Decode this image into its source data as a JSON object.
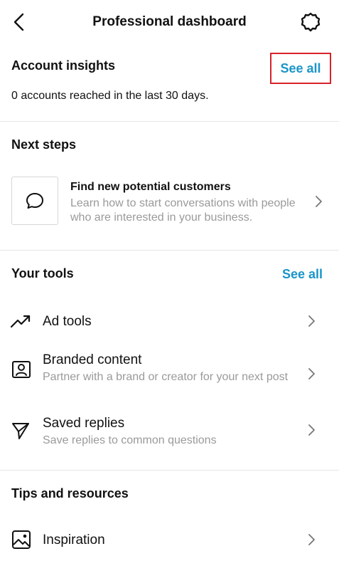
{
  "header": {
    "title": "Professional dashboard"
  },
  "account_insights": {
    "title": "Account insights",
    "see_all": "See all",
    "summary": "0 accounts reached in the last 30 days."
  },
  "next_steps": {
    "title": "Next steps",
    "card": {
      "title": "Find new potential customers",
      "description": "Learn how to start conversations with people who are interested in your business."
    }
  },
  "tools": {
    "title": "Your tools",
    "see_all": "See all",
    "items": [
      {
        "label": "Ad tools",
        "description": ""
      },
      {
        "label": "Branded content",
        "description": "Partner with a brand or creator for your next post"
      },
      {
        "label": "Saved replies",
        "description": "Save replies to common questions"
      }
    ]
  },
  "tips": {
    "title": "Tips and resources",
    "items": [
      {
        "label": "Inspiration"
      }
    ]
  },
  "colors": {
    "accent": "#1a95c9",
    "highlight_border": "#d9222a",
    "subtext": "#9a9a9a"
  }
}
